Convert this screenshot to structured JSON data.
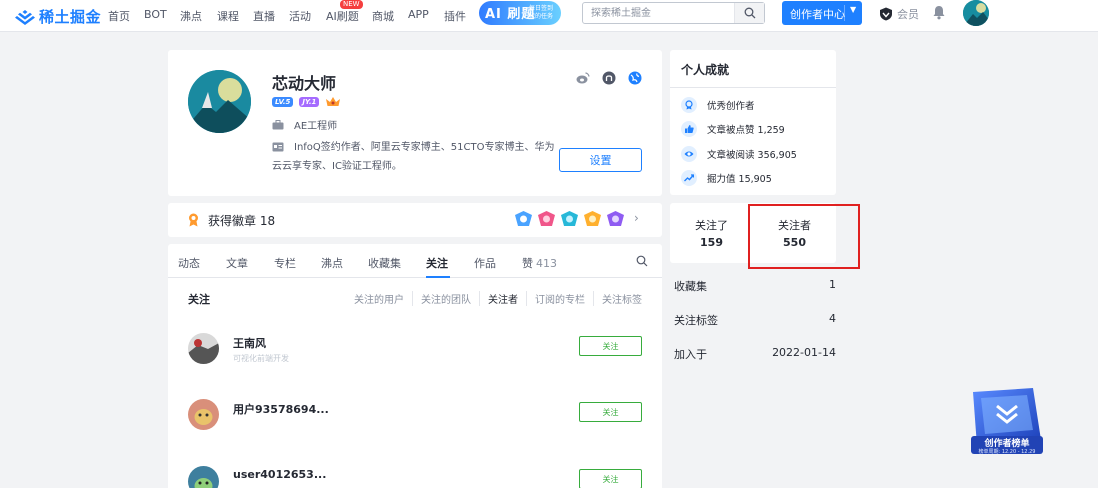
{
  "header": {
    "logo_text": "稀土掘金",
    "nav": [
      "首页",
      "BOT",
      "沸点",
      "课程",
      "直播",
      "活动",
      "AI刷题",
      "商城",
      "APP",
      "插件"
    ],
    "new_tag": "NEW",
    "ai_banner": {
      "title": "AI 刷题",
      "subtitle": "每日签到 我的任务"
    },
    "search": {
      "placeholder": "探索稀土掘金"
    },
    "creator_center": "创作者中心",
    "vip_label": "会员"
  },
  "profile": {
    "name": "芯动大师",
    "badges": {
      "level": "LV.5",
      "jy": "JY.1"
    },
    "job": "AE工程师",
    "bio": "InfoQ签约作者、阿里云专家博主、51CTO专家博主、华为云云享专家、IC验证工程师。",
    "settings_button": "设置"
  },
  "badges_earned": {
    "label": "获得徽章 18"
  },
  "tabs": [
    {
      "label": "动态"
    },
    {
      "label": "文章"
    },
    {
      "label": "专栏"
    },
    {
      "label": "沸点"
    },
    {
      "label": "收藏集"
    },
    {
      "label": "关注"
    },
    {
      "label": "作品"
    },
    {
      "label": "赞",
      "count": "413"
    }
  ],
  "follow_section": {
    "title": "关注",
    "sub_tabs": [
      "关注的用户",
      "关注的团队",
      "关注者",
      "订阅的专栏",
      "关注标签"
    ],
    "active_sub_tab": "关注者",
    "items": [
      {
        "name": "王南风",
        "desc": "可视化前端开发",
        "button": "关注"
      },
      {
        "name": "用户93578694...",
        "desc": "",
        "button": "关注"
      },
      {
        "name": "user4012653...",
        "desc": "",
        "button": "关注"
      }
    ]
  },
  "achievements": {
    "title": "个人成就",
    "items": [
      {
        "icon": "medal-icon",
        "text": "优秀创作者"
      },
      {
        "icon": "thumb-up-icon",
        "text": "文章被点赞 1,259"
      },
      {
        "icon": "eye-icon",
        "text": "文章被阅读 356,905"
      },
      {
        "icon": "trend-icon",
        "text": "掘力值 15,905"
      }
    ]
  },
  "follow_stats": {
    "following": {
      "label": "关注了",
      "value": "159"
    },
    "followers": {
      "label": "关注者",
      "value": "550"
    }
  },
  "meta": [
    {
      "label": "收藏集",
      "value": "1"
    },
    {
      "label": "关注标签",
      "value": "4"
    },
    {
      "label": "加入于",
      "value": "2022-01-14"
    }
  ],
  "rank_widget": {
    "title": "创作者榜单",
    "subtitle": "榜单周期: 12.20 - 12.29"
  },
  "colors": {
    "brand": "#1e80ff",
    "follow_green": "#37ac3d",
    "highlight_red": "#e02020"
  }
}
